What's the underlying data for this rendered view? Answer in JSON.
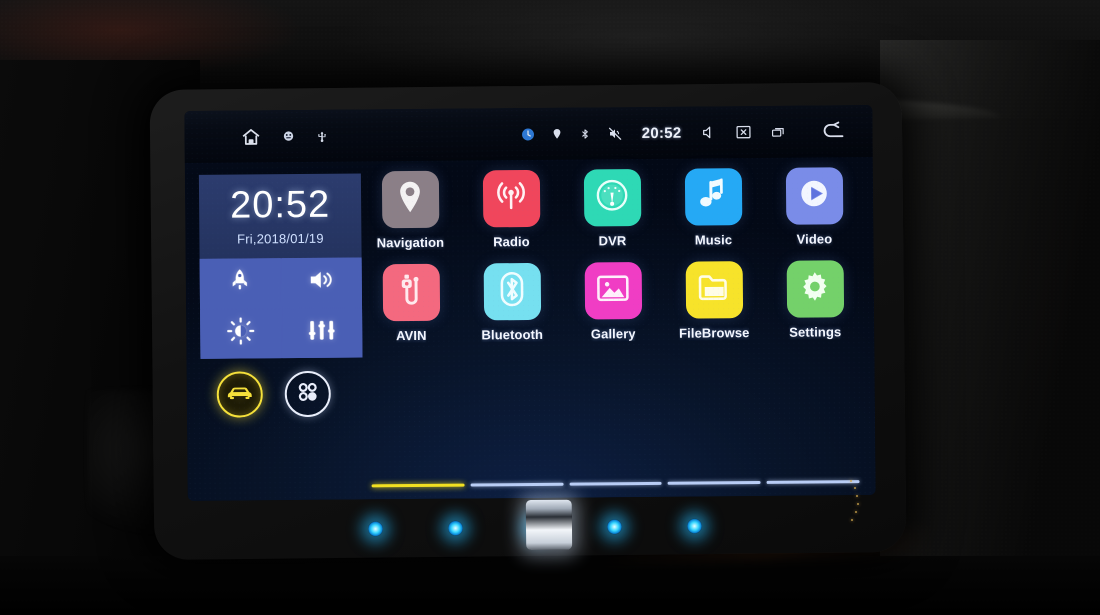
{
  "device": {
    "name": "Android car head unit",
    "screen_state": "home"
  },
  "statusbar": {
    "left_icons": [
      "home-icon",
      "android-debug-icon",
      "usb-icon"
    ],
    "right_icons": [
      "sync-icon",
      "location-icon",
      "bluetooth-icon",
      "mute-icon"
    ],
    "time": "20:52",
    "nav_icons": [
      "volume-icon",
      "screen-off-icon",
      "recents-icon",
      "back-icon"
    ]
  },
  "widget": {
    "clock_time": "20:52",
    "clock_date": "Fri,2018/01/19",
    "tiles": [
      {
        "name": "boost-tile",
        "icon": "rocket-icon"
      },
      {
        "name": "volume-tile",
        "icon": "speaker-icon"
      },
      {
        "name": "brightness-tile",
        "icon": "brightness-icon"
      },
      {
        "name": "equalizer-tile",
        "icon": "equalizer-icon"
      }
    ],
    "car_button": "car-icon",
    "drawer_button": "app-drawer-icon"
  },
  "apps": [
    [
      {
        "label": "Navigation",
        "icon": "map-pin-icon",
        "color": "#8b7f87"
      },
      {
        "label": "Radio",
        "icon": "radio-wave-icon",
        "color": "#f0465c"
      },
      {
        "label": "DVR",
        "icon": "gauge-icon",
        "color": "#2ed9b5"
      },
      {
        "label": "Music",
        "icon": "music-note-icon",
        "color": "#25a9f5"
      },
      {
        "label": "Video",
        "icon": "play-circle-icon",
        "color": "#7a8ce8"
      }
    ],
    [
      {
        "label": "AVIN",
        "icon": "avin-plug-icon",
        "color": "#f4697f"
      },
      {
        "label": "Bluetooth",
        "icon": "bluetooth-icon",
        "color": "#76e0f0"
      },
      {
        "label": "Gallery",
        "icon": "photo-icon",
        "color": "#f03dc4"
      },
      {
        "label": "FileBrowse",
        "icon": "folder-icon",
        "color": "#f7e32a"
      },
      {
        "label": "Settings",
        "icon": "gear-icon",
        "color": "#74d16a"
      }
    ]
  ],
  "pager": {
    "total": 5,
    "active_index": 0,
    "active_color": "#f2e021",
    "inactive_color": "#b9cdf5"
  },
  "hardware": {
    "buttons": [
      "led-1",
      "led-2",
      "led-3",
      "volume-knob",
      "led-4",
      "led-5"
    ]
  },
  "colors": {
    "widget_clock_bg": "#2c3c6e",
    "widget_tile_bg": "#4a5fb5",
    "screen_bg": "#081429",
    "accent_yellow": "#f5e03a",
    "led_cyan": "#38d6ff"
  }
}
